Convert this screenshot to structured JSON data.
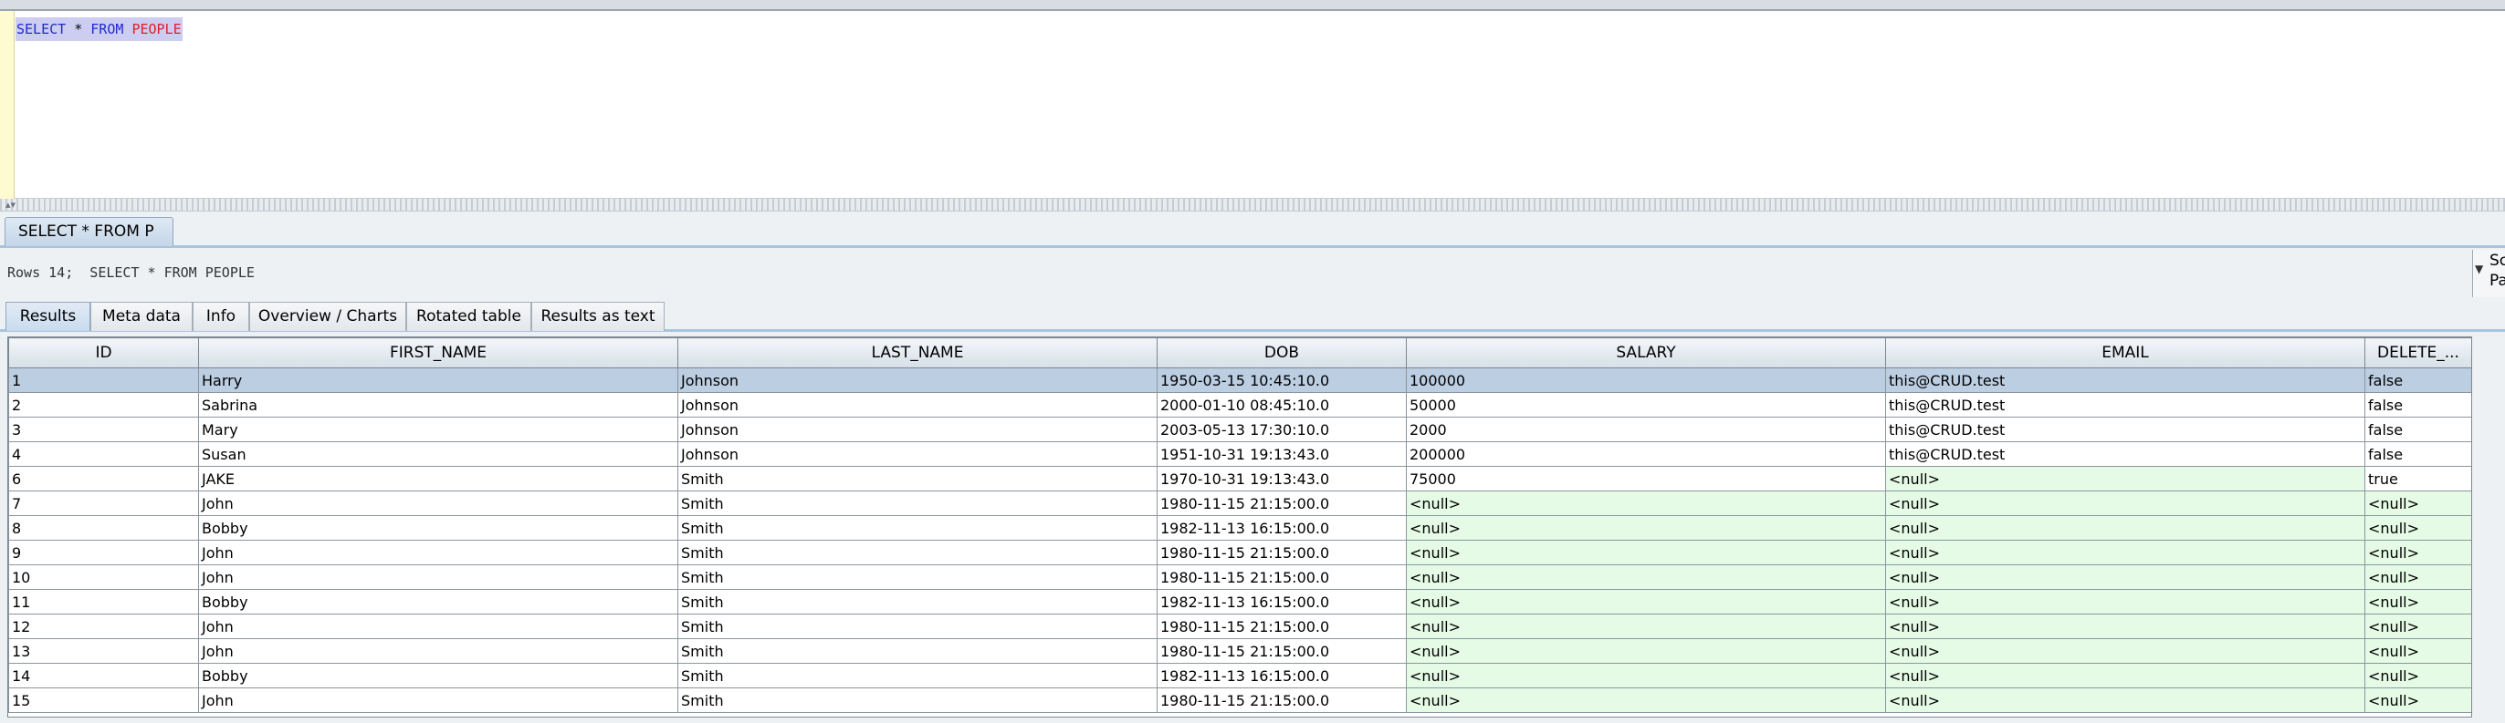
{
  "editor": {
    "sql_select": "SELECT",
    "sql_star": " * ",
    "sql_from": "FROM",
    "sql_space": " ",
    "sql_table": "PEOPLE"
  },
  "query_tab": {
    "label": "SELECT * FROM P"
  },
  "status": {
    "text": "Rows 14;  SELECT * FROM PEOPLE"
  },
  "right_widget": {
    "line1": "Sc",
    "line2": "Pa"
  },
  "result_tabs": [
    {
      "label": "Results",
      "active": true
    },
    {
      "label": "Meta data",
      "active": false
    },
    {
      "label": "Info",
      "active": false
    },
    {
      "label": "Overview / Charts",
      "active": false
    },
    {
      "label": "Rotated table",
      "active": false
    },
    {
      "label": "Results as text",
      "active": false
    }
  ],
  "table": {
    "columns": [
      "ID",
      "FIRST_NAME",
      "LAST_NAME",
      "DOB",
      "SALARY",
      "EMAIL",
      "DELETE_..."
    ],
    "null_text": "<null>",
    "rows": [
      [
        "1",
        "Harry",
        "Johnson",
        "1950-03-15 10:45:10.0",
        "100000",
        "this@CRUD.test",
        "false"
      ],
      [
        "2",
        "Sabrina",
        "Johnson",
        "2000-01-10 08:45:10.0",
        "50000",
        "this@CRUD.test",
        "false"
      ],
      [
        "3",
        "Mary",
        "Johnson",
        "2003-05-13 17:30:10.0",
        "2000",
        "this@CRUD.test",
        "false"
      ],
      [
        "4",
        "Susan",
        "Johnson",
        "1951-10-31 19:13:43.0",
        "200000",
        "this@CRUD.test",
        "false"
      ],
      [
        "6",
        "JAKE",
        "Smith",
        "1970-10-31 19:13:43.0",
        "75000",
        "<null>",
        "true"
      ],
      [
        "7",
        "John",
        "Smith",
        "1980-11-15 21:15:00.0",
        "<null>",
        "<null>",
        "<null>"
      ],
      [
        "8",
        "Bobby",
        "Smith",
        "1982-11-13 16:15:00.0",
        "<null>",
        "<null>",
        "<null>"
      ],
      [
        "9",
        "John",
        "Smith",
        "1980-11-15 21:15:00.0",
        "<null>",
        "<null>",
        "<null>"
      ],
      [
        "10",
        "John",
        "Smith",
        "1980-11-15 21:15:00.0",
        "<null>",
        "<null>",
        "<null>"
      ],
      [
        "11",
        "Bobby",
        "Smith",
        "1982-11-13 16:15:00.0",
        "<null>",
        "<null>",
        "<null>"
      ],
      [
        "12",
        "John",
        "Smith",
        "1980-11-15 21:15:00.0",
        "<null>",
        "<null>",
        "<null>"
      ],
      [
        "13",
        "John",
        "Smith",
        "1980-11-15 21:15:00.0",
        "<null>",
        "<null>",
        "<null>"
      ],
      [
        "14",
        "Bobby",
        "Smith",
        "1982-11-13 16:15:00.0",
        "<null>",
        "<null>",
        "<null>"
      ],
      [
        "15",
        "John",
        "Smith",
        "1980-11-15 21:15:00.0",
        "<null>",
        "<null>",
        "<null>"
      ]
    ],
    "selected_row": 0
  },
  "colors": {
    "selected_row": "#bccee2",
    "null_cell": "#e6fbe6",
    "sql_keyword": "#1e2ad0",
    "sql_table": "#e01d2b"
  }
}
